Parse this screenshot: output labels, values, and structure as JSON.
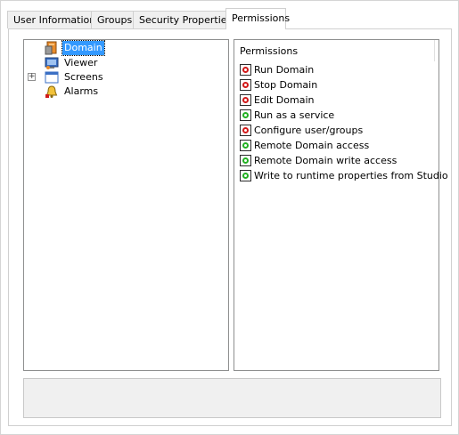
{
  "colors": {
    "denied": "#d21a1a",
    "granted": "#22b022",
    "selection": "#3399ff"
  },
  "tabs": [
    {
      "label": "User Information",
      "active": false
    },
    {
      "label": "Groups",
      "active": false
    },
    {
      "label": "Security Properties",
      "active": false
    },
    {
      "label": "Permissions",
      "active": true
    }
  ],
  "tree": [
    {
      "label": "Domain",
      "icon": "domain-icon",
      "selected": true
    },
    {
      "label": "Viewer",
      "icon": "viewer-icon",
      "selected": false
    },
    {
      "label": "Screens",
      "icon": "screens-icon",
      "selected": false,
      "expander": "+"
    },
    {
      "label": "Alarms",
      "icon": "alarm-bell-icon",
      "selected": false
    }
  ],
  "permissions": {
    "header": "Permissions",
    "items": [
      {
        "label": "Run Domain",
        "state": "denied"
      },
      {
        "label": "Stop Domain",
        "state": "denied"
      },
      {
        "label": "Edit Domain",
        "state": "denied"
      },
      {
        "label": "Run as a service",
        "state": "granted"
      },
      {
        "label": "Configure user/groups",
        "state": "denied"
      },
      {
        "label": "Remote Domain access",
        "state": "granted"
      },
      {
        "label": "Remote Domain write access",
        "state": "granted"
      },
      {
        "label": "Write to runtime properties from Studio",
        "state": "granted"
      }
    ]
  }
}
